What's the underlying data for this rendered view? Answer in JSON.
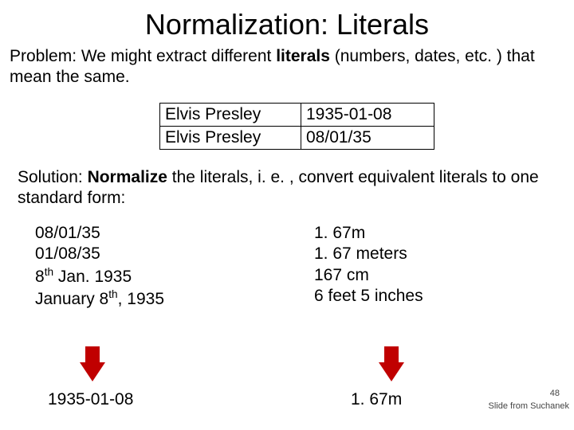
{
  "title": "Normalization: Literals",
  "problem_prefix": "Problem: We might extract different ",
  "problem_bold": "literals",
  "problem_suffix": " (numbers, dates, etc. ) that mean the same.",
  "table": {
    "r1c1": "Elvis Presley",
    "r1c2": "1935-01-08",
    "r2c1": "Elvis Presley",
    "r2c2": "08/01/35"
  },
  "solution_prefix": "Solution: ",
  "solution_bold": "Normalize",
  "solution_suffix": " the literals, i. e. , convert equivalent literals to one standard form:",
  "dates": {
    "d1": "08/01/35",
    "d2": "01/08/35",
    "d3_pre": "8",
    "d3_sup": "th",
    "d3_post": " Jan. 1935",
    "d4_pre": "January 8",
    "d4_sup": "th",
    "d4_post": ", 1935"
  },
  "lengths": {
    "l1": "1. 67m",
    "l2": "1. 67 meters",
    "l3": "167 cm",
    "l4": "6 feet 5 inches"
  },
  "result_date": "1935-01-08",
  "result_length": "1. 67m",
  "page_number": "48",
  "credit": "Slide from Suchanek"
}
